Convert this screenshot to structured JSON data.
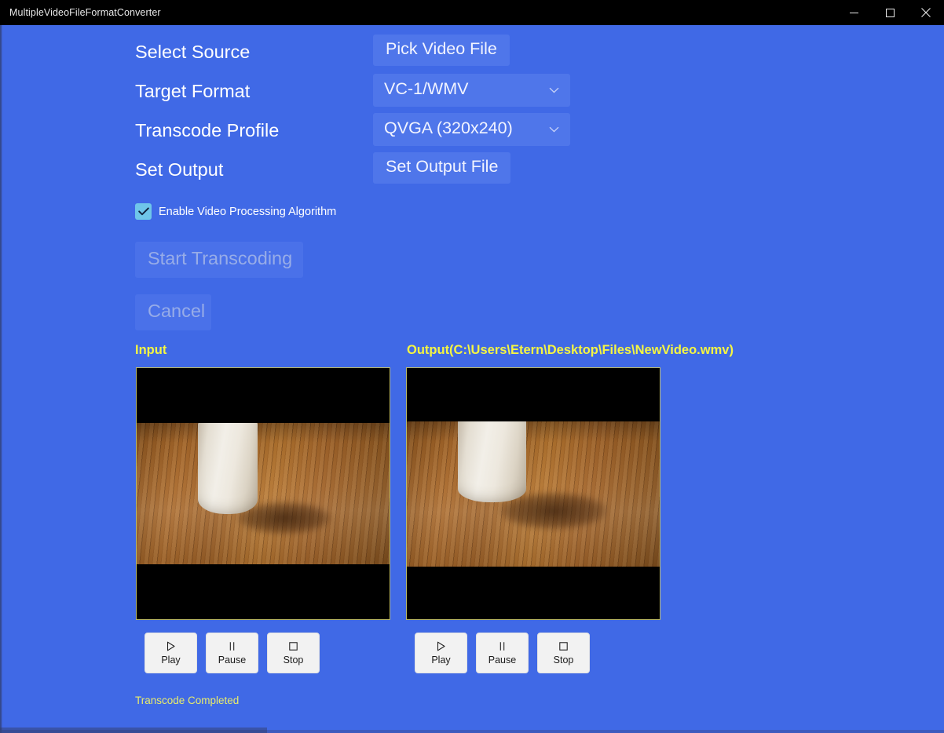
{
  "window": {
    "title": "MultipleVideoFileFormatConverter",
    "controls": [
      {
        "name": "minimize",
        "glyph": "minimize-icon"
      },
      {
        "name": "maximize",
        "glyph": "maximize-icon"
      },
      {
        "name": "close",
        "glyph": "close-icon"
      }
    ]
  },
  "form": {
    "rows": [
      {
        "label": "Select Source",
        "control_type": "button",
        "value": "Pick Video File"
      },
      {
        "label": "Target Format",
        "control_type": "combobox",
        "value": "VC-1/WMV"
      },
      {
        "label": "Transcode Profile",
        "control_type": "combobox",
        "value": "QVGA (320x240)"
      },
      {
        "label": "Set Output",
        "control_type": "button",
        "value": "Set Output File"
      }
    ]
  },
  "checkbox": {
    "label": "Enable Video Processing Algorithm",
    "checked": true,
    "box_color": "#6FC6EA",
    "check_color": "#10213F"
  },
  "actions": {
    "start_label": "Start Transcoding",
    "cancel_label": "Cancel",
    "disabled": true,
    "disabled_text_color": "#97ACE8"
  },
  "preview": {
    "input_title": "Input",
    "output_title": "Output(C:\\Users\\Etern\\Desktop\\Files\\NewVideo.wmv)",
    "title_color": "#F5F542",
    "frame_border_color": "#B9B96A",
    "letterbox_color": "#000000",
    "media_buttons": [
      {
        "name": "play",
        "glyph": "play-icon",
        "label": "Play"
      },
      {
        "name": "pause",
        "glyph": "pause-icon",
        "label": "Pause"
      },
      {
        "name": "stop",
        "glyph": "stop-icon",
        "label": "Stop"
      }
    ]
  },
  "status": {
    "text": "Transcode Completed",
    "color": "#E9EC6B"
  },
  "theme": {
    "page_background": "#4069E6",
    "control_background": "#4F76EA",
    "titlebar_background": "#000000",
    "text_color": "#FFFFFF"
  }
}
